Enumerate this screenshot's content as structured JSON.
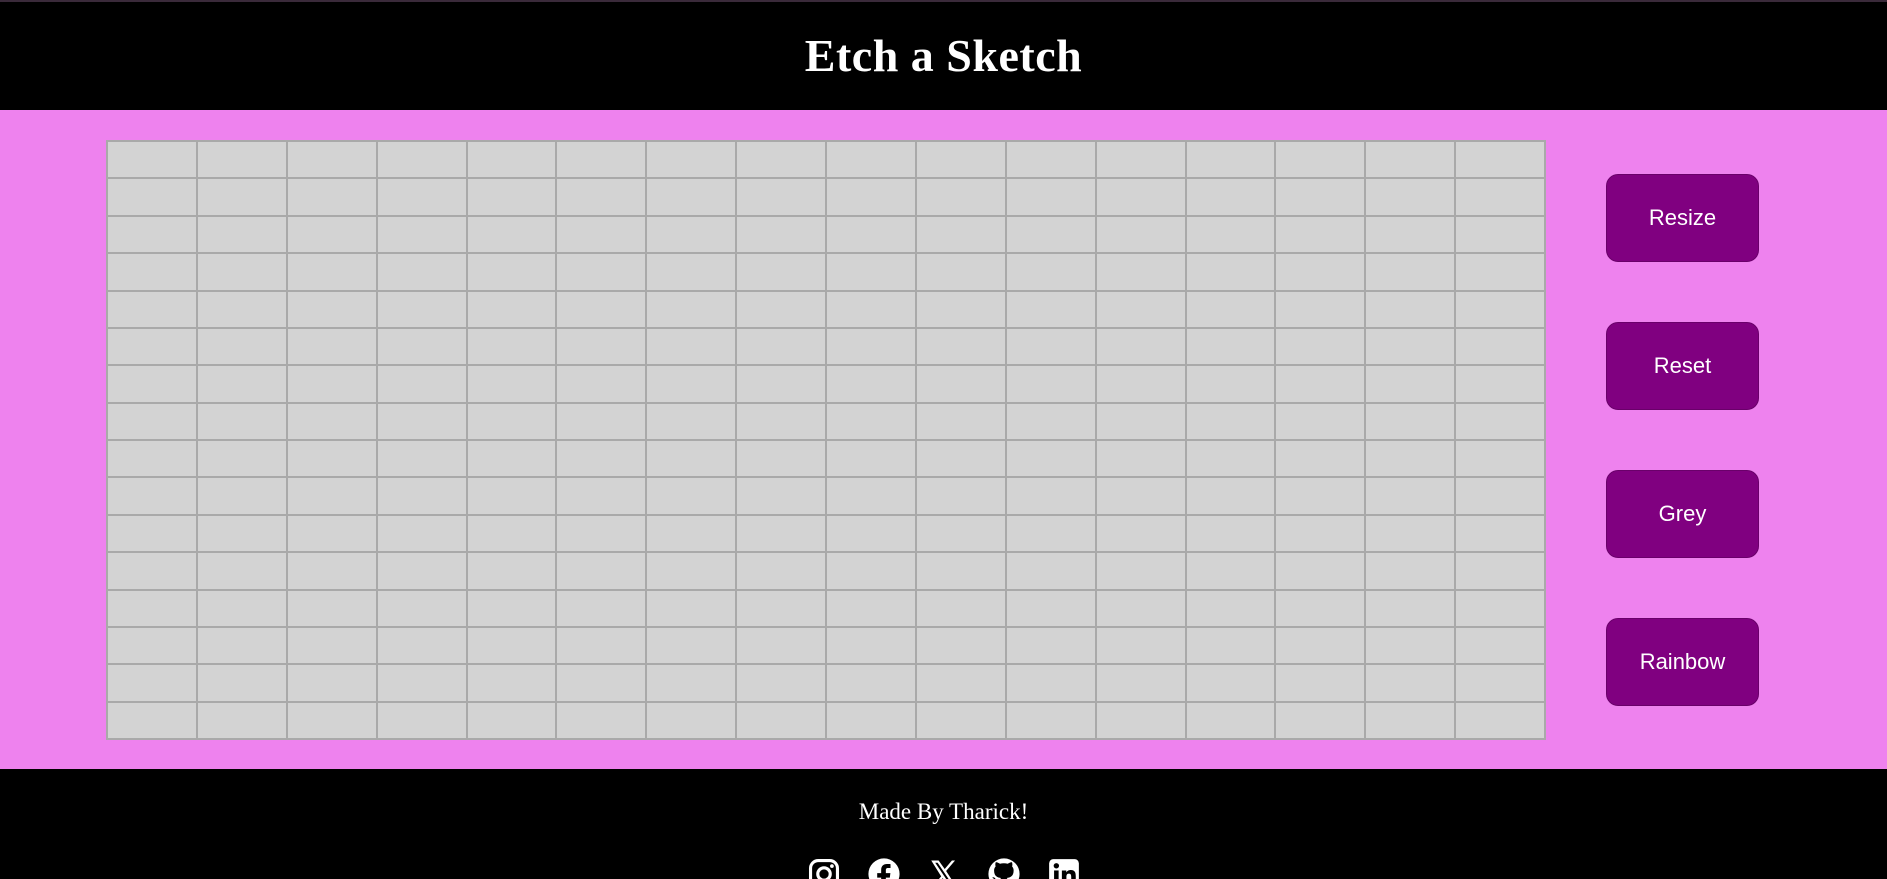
{
  "header": {
    "title": "Etch a Sketch"
  },
  "grid": {
    "columns": 16,
    "rows": 16,
    "cell_color": "#d3d3d3",
    "line_color": "#a9a9a9"
  },
  "controls": {
    "buttons": [
      {
        "label": "Resize"
      },
      {
        "label": "Reset"
      },
      {
        "label": "Grey"
      },
      {
        "label": "Rainbow"
      }
    ]
  },
  "footer": {
    "credit": "Made By Tharick!",
    "socials": [
      {
        "icon": "instagram-icon"
      },
      {
        "icon": "facebook-icon"
      },
      {
        "icon": "x-icon"
      },
      {
        "icon": "github-icon"
      },
      {
        "icon": "linkedin-icon"
      }
    ]
  },
  "colors": {
    "background": "#ee82ee",
    "header_footer": "#000000",
    "button": "#800080",
    "text": "#ffffff"
  }
}
